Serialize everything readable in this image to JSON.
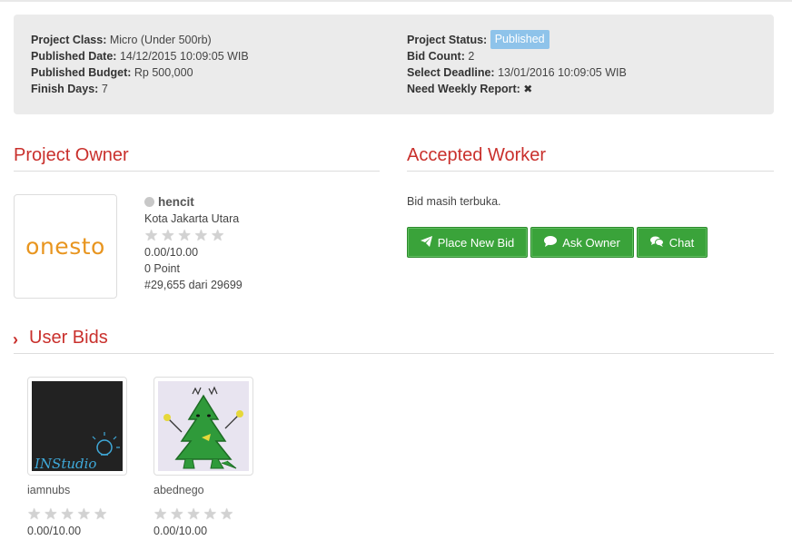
{
  "project": {
    "class_label": "Project Class:",
    "class_value": "Micro (Under 500rb)",
    "published_date_label": "Published Date:",
    "published_date_value": "14/12/2015 10:09:05 WIB",
    "published_budget_label": "Published Budget:",
    "published_budget_value": "Rp 500,000",
    "finish_days_label": "Finish Days:",
    "finish_days_value": "7",
    "status_label": "Project Status:",
    "status_value": "Published",
    "bid_count_label": "Bid Count:",
    "bid_count_value": "2",
    "select_deadline_label": "Select Deadline:",
    "select_deadline_value": "13/01/2016 10:09:05 WIB",
    "weekly_report_label": "Need Weekly Report:",
    "weekly_report_icon": "times-icon",
    "status_color": "#8ec3ea"
  },
  "owner_section": {
    "title": "Project Owner",
    "logo_text": "onesto",
    "name": "hencit",
    "location": "Kota Jakarta Utara",
    "rating": "0.00/10.00",
    "rating_value": 0,
    "points": "0 Point",
    "rank": "#29,655 dari 29699"
  },
  "worker_section": {
    "title": "Accepted Worker",
    "status_text": "Bid masih terbuka.",
    "buttons": [
      {
        "label": "Place New Bid",
        "icon": "paper-plane-icon"
      },
      {
        "label": "Ask Owner",
        "icon": "comment-icon"
      },
      {
        "label": "Chat",
        "icon": "comments-icon"
      }
    ]
  },
  "bids_section": {
    "title": "User Bids",
    "icon": "chevron-right-icon",
    "bids": [
      {
        "name": "iamnubs",
        "rating": "0.00/10.00",
        "avatar_text": "INStudio"
      },
      {
        "name": "abednego",
        "rating": "0.00/10.00"
      }
    ]
  },
  "colors": {
    "accent_red": "#c9302c",
    "button_green": "#3aa33a",
    "panel_bg": "#ebebeb"
  }
}
